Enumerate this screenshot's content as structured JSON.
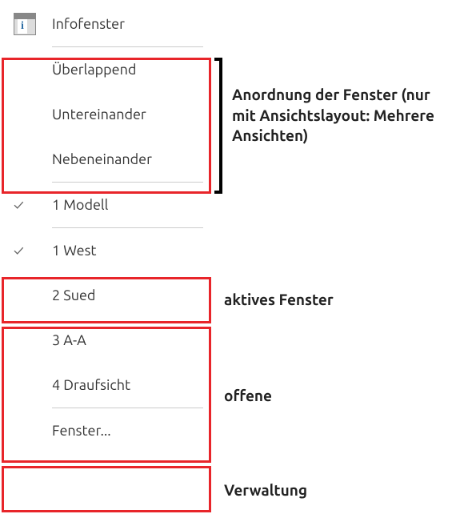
{
  "menu": {
    "infofenster": "Infofenster",
    "arrangement": {
      "cascade": "Überlappend",
      "horizontal": "Untereinander",
      "vertical": "Nebeneinander"
    },
    "model": "1 Modell",
    "windows": {
      "w1": "1 West",
      "w2": "2 Sued",
      "w3": "3 A-A",
      "w4": "4 Draufsicht"
    },
    "manage": "Fenster..."
  },
  "annotations": {
    "arrangement": "Anordnung der Fenster (nur mit Ansichtslayout: Mehrere Ansichten)",
    "active": "aktives Fenster",
    "open": "offene",
    "manage": "Verwaltung"
  }
}
